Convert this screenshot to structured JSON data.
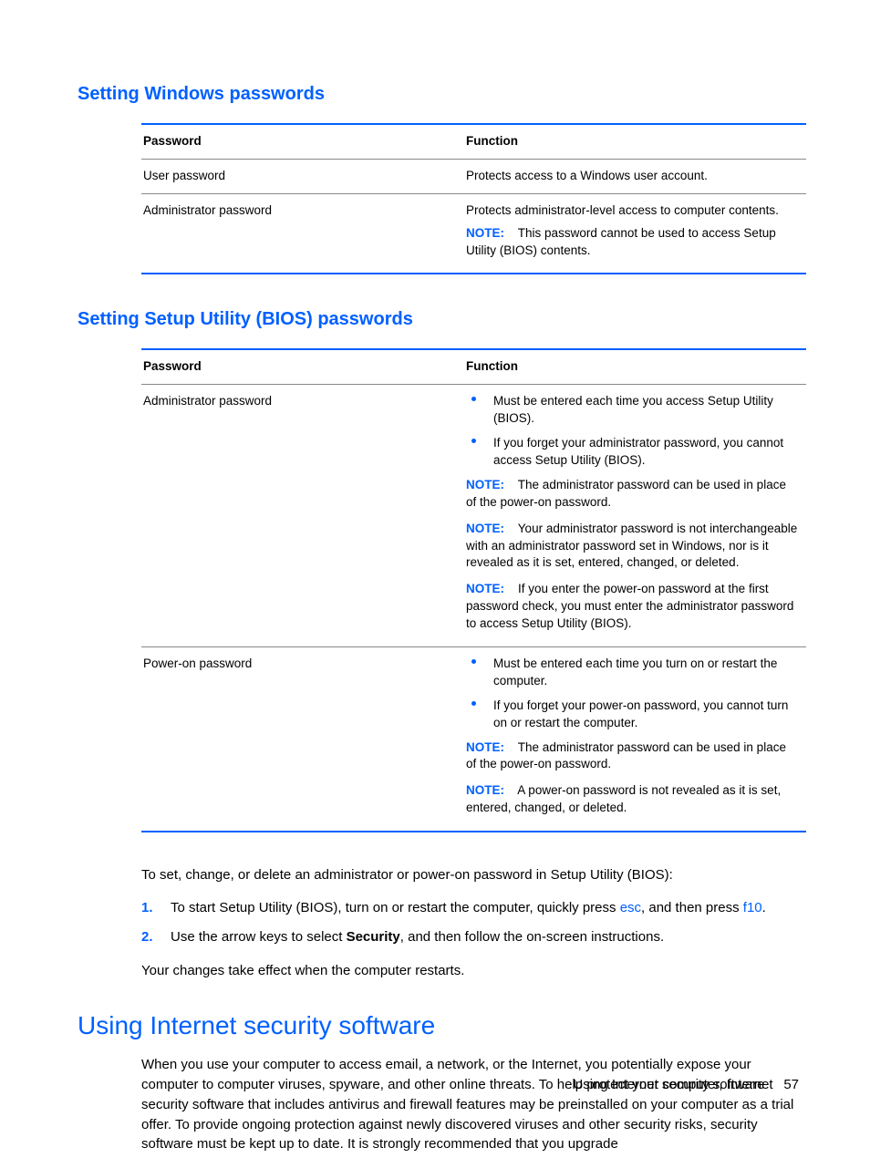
{
  "section1": {
    "heading": "Setting Windows passwords",
    "header_col1": "Password",
    "header_col2": "Function",
    "rows": [
      {
        "name": "User password",
        "func": "Protects access to a Windows user account."
      },
      {
        "name": "Administrator password",
        "func": "Protects administrator-level access to computer contents.",
        "note_label": "NOTE:",
        "note": "This password cannot be used to access Setup Utility (BIOS) contents."
      }
    ]
  },
  "section2": {
    "heading": "Setting Setup Utility (BIOS) passwords",
    "header_col1": "Password",
    "header_col2": "Function",
    "rows": [
      {
        "name": "Administrator password",
        "bullets": [
          "Must be entered each time you access Setup Utility (BIOS).",
          "If you forget your administrator password, you cannot access Setup Utility (BIOS)."
        ],
        "notes": [
          "The administrator password can be used in place of the power-on password.",
          "Your administrator password is not interchangeable with an administrator password set in Windows, nor is it revealed as it is set, entered, changed, or deleted.",
          "If you enter the power-on password at the first password check, you must enter the administrator password to access Setup Utility (BIOS)."
        ]
      },
      {
        "name": "Power-on password",
        "bullets": [
          "Must be entered each time you turn on or restart the computer.",
          "If you forget your power-on password, you cannot turn on or restart the computer."
        ],
        "notes": [
          "The administrator password can be used in place of the power-on password.",
          "A power-on password is not revealed as it is set, entered, changed, or deleted."
        ]
      }
    ],
    "note_label": "NOTE:"
  },
  "instructions": {
    "intro": "To set, change, or delete an administrator or power-on password in Setup Utility (BIOS):",
    "steps": [
      {
        "num": "1.",
        "pre": "To start Setup Utility (BIOS), turn on or restart the computer, quickly press ",
        "kw1": "esc",
        "mid": ", and then press ",
        "kw2": "f10",
        "post": "."
      },
      {
        "num": "2.",
        "pre": "Use the arrow keys to select ",
        "bold": "Security",
        "post": ", and then follow the on-screen instructions."
      }
    ],
    "outro": "Your changes take effect when the computer restarts."
  },
  "section3": {
    "heading": "Using Internet security software",
    "body": "When you use your computer to access email, a network, or the Internet, you potentially expose your computer to computer viruses, spyware, and other online threats. To help protect your computer, Internet security software that includes antivirus and firewall features may be preinstalled on your computer as a trial offer. To provide ongoing protection against newly discovered viruses and other security risks, security software must be kept up to date. It is strongly recommended that you upgrade"
  },
  "footer": {
    "text": "Using Internet security software",
    "page": "57"
  }
}
